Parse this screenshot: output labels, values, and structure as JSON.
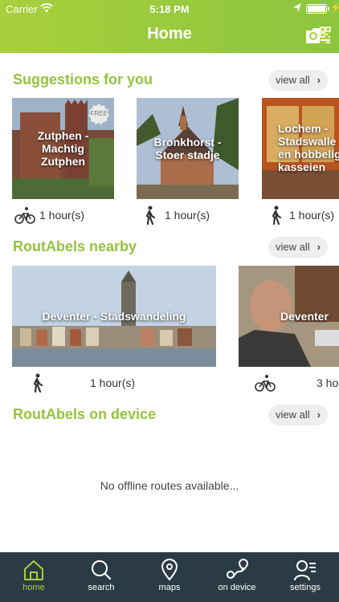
{
  "status_bar": {
    "carrier": "Carrier",
    "time": "5:18 PM"
  },
  "header": {
    "title": "Home"
  },
  "suggestions": {
    "title": "Suggestions for you",
    "view_all": "view all",
    "cards": [
      {
        "label": "Zutphen - Machtig Zutphen",
        "badge": "FREE",
        "mode": "bicycle-icon",
        "duration": "1 hour(s)"
      },
      {
        "label": "Bronkhorst - Stoer stadje",
        "mode": "walking-icon",
        "duration": "1 hour(s)"
      },
      {
        "label": "Lochem - Stadswalle en hobbelig kasseien",
        "mode": "walking-icon",
        "duration": "1 hour(s)"
      }
    ]
  },
  "nearby": {
    "title": "RoutAbels nearby",
    "view_all": "view all",
    "cards": [
      {
        "label": "Deventer - Stadswandeling",
        "mode": "walking-icon",
        "duration": "1 hour(s)"
      },
      {
        "label": "Deventer",
        "mode": "bicycle-icon",
        "duration": "3 ho"
      }
    ]
  },
  "on_device": {
    "title": "RoutAbels on device",
    "view_all": "view all",
    "empty_message": "No offline routes available..."
  },
  "tabs": [
    {
      "label": "home",
      "icon": "home-icon",
      "active": true
    },
    {
      "label": "search",
      "icon": "search-icon",
      "active": false
    },
    {
      "label": "maps",
      "icon": "map-pin-icon",
      "active": false
    },
    {
      "label": "on device",
      "icon": "route-icon",
      "active": false
    },
    {
      "label": "settings",
      "icon": "settings-user-icon",
      "active": false
    }
  ],
  "colors": {
    "accent": "#94c43b",
    "header": "#a8cf3c",
    "tabbar": "#2b3b46"
  }
}
